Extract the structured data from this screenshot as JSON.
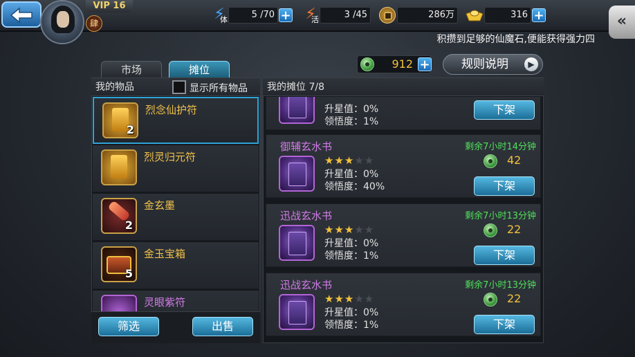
{
  "header": {
    "vip_label": "VIP 16",
    "rank_badge": "肆",
    "stamina": {
      "icon_text": "体",
      "value": "5 /70"
    },
    "vitality": {
      "icon_text": "活",
      "value": "3 /45"
    },
    "copper": {
      "value": "286万"
    },
    "gold": {
      "value": "316"
    },
    "side_button": "«",
    "marquee": "积攒到足够的仙魔石,便能获得强力四"
  },
  "tabs": [
    {
      "label": "市场",
      "active": false
    },
    {
      "label": "摊位",
      "active": true
    }
  ],
  "currency": {
    "value": "912"
  },
  "rules_button": "规则说明",
  "my_items": {
    "title": "我的物品",
    "show_all_label": "显示所有物品",
    "items": [
      {
        "name": "烈念仙护符",
        "qty": "2",
        "rarity": "gold"
      },
      {
        "name": "烈灵归元符",
        "qty": "",
        "rarity": "gold"
      },
      {
        "name": "金玄墨",
        "qty": "2",
        "rarity": "gold"
      },
      {
        "name": "金玉宝箱",
        "qty": "5",
        "rarity": "gold"
      },
      {
        "name": "灵眼紫符",
        "qty": "",
        "rarity": "purple"
      }
    ],
    "filter_button": "筛选",
    "sell_button": "出售"
  },
  "my_stall": {
    "title": "我的摊位 7/8",
    "listings": [
      {
        "name": "",
        "stars": 0,
        "upgrade": "升星值：0%",
        "comprehension": "领悟度：1%",
        "remaining": "",
        "price": "",
        "button": "下架"
      },
      {
        "name": "御辅玄水书",
        "stars": 3,
        "upgrade": "升星值：0%",
        "comprehension": "领悟度：40%",
        "remaining": "剩余7小时14分钟",
        "price": "42",
        "button": "下架"
      },
      {
        "name": "迅战玄水书",
        "stars": 3,
        "upgrade": "升星值：0%",
        "comprehension": "领悟度：1%",
        "remaining": "剩余7小时13分钟",
        "price": "22",
        "button": "下架"
      },
      {
        "name": "迅战玄水书",
        "stars": 3,
        "upgrade": "升星值：0%",
        "comprehension": "领悟度：1%",
        "remaining": "剩余7小时13分钟",
        "price": "22",
        "button": "下架"
      }
    ]
  }
}
